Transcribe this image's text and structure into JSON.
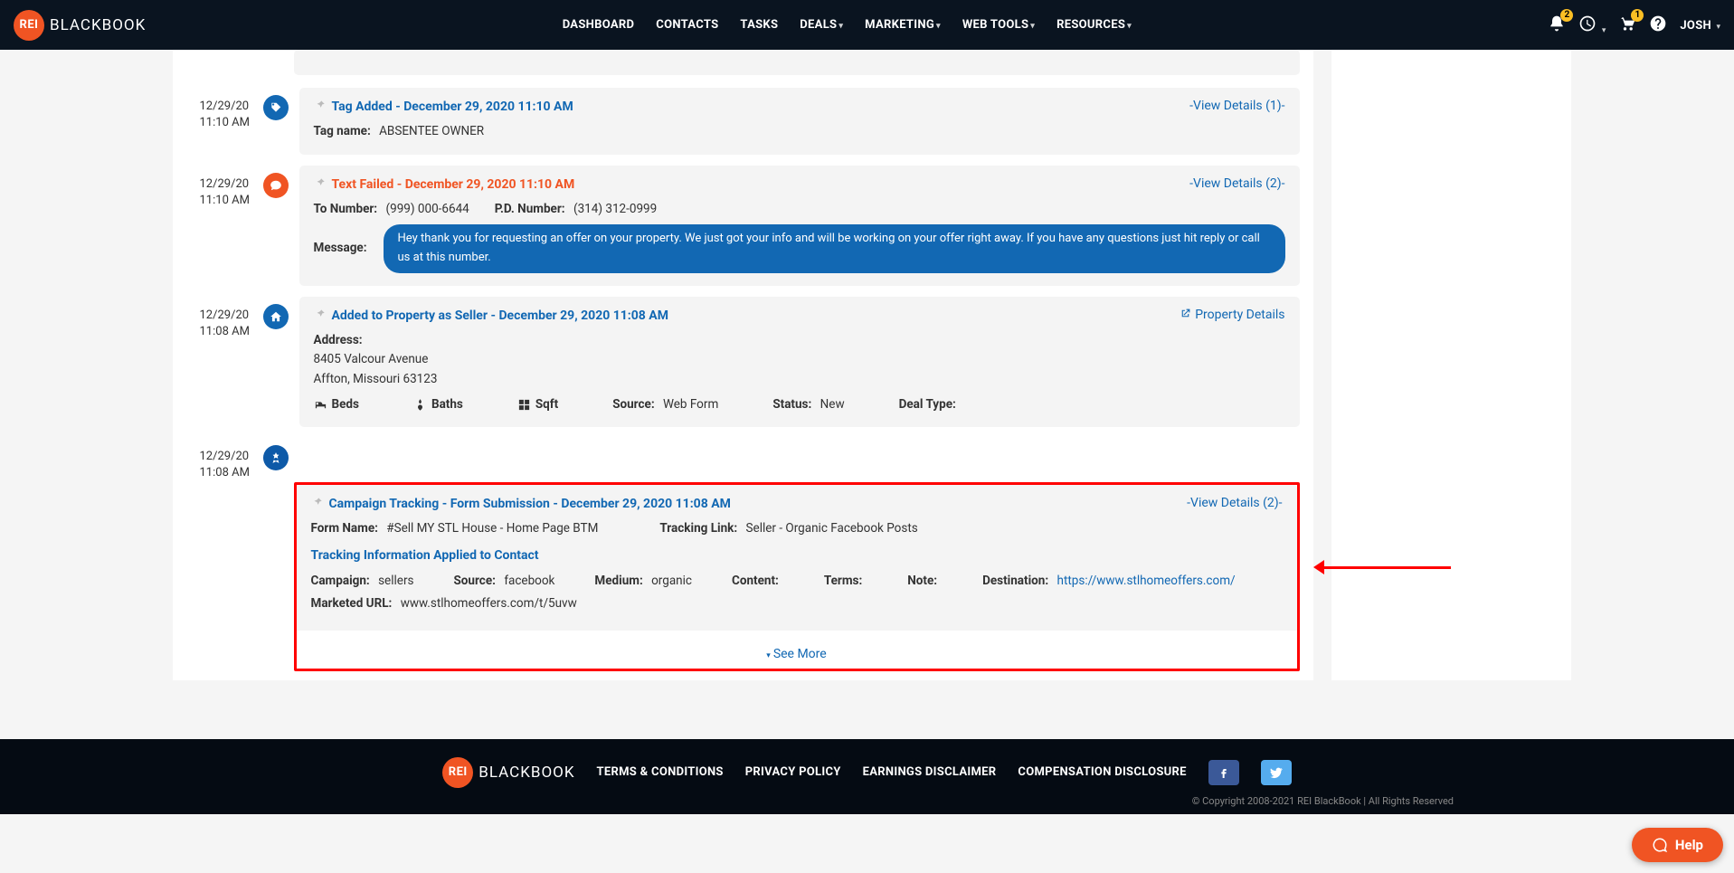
{
  "header": {
    "logo_badge": "REI",
    "logo_text": "BLACKBOOK",
    "nav": [
      "DASHBOARD",
      "CONTACTS",
      "TASKS",
      "DEALS",
      "MARKETING",
      "WEB TOOLS",
      "RESOURCES"
    ],
    "nav_carets": [
      false,
      false,
      false,
      true,
      true,
      true,
      true
    ],
    "bell_badge": "2",
    "cart_badge": "1",
    "user": "JOSH"
  },
  "items": [
    {
      "date": "12/29/20",
      "time": "11:10 AM",
      "icon": "tag",
      "icon_color": "blue",
      "title": "Tag Added - December 29, 2020 11:10 AM",
      "title_class": "blue",
      "action": "-View Details (1)-",
      "lines": [
        {
          "label": "Tag name:",
          "value": "ABSENTEE OWNER"
        }
      ]
    },
    {
      "date": "12/29/20",
      "time": "11:10 AM",
      "icon": "comment",
      "icon_color": "orange",
      "title": "Text Failed - December 29, 2020 11:10 AM",
      "title_class": "red",
      "action": "-View Details (2)-",
      "text_row": {
        "to_label": "To Number:",
        "to_val": "(999) 000-6644",
        "pd_label": "P.D. Number:",
        "pd_val": "(314) 312-0999"
      },
      "msg_label": "Message:",
      "msg": "Hey thank you for requesting an offer on your property. We just got your info and will be working on your offer right away. If you have any questions just hit reply or call us at this number."
    },
    {
      "date": "12/29/20",
      "time": "11:08 AM",
      "icon": "home",
      "icon_color": "blue",
      "title": "Added to Property as Seller - December 29, 2020 11:08 AM",
      "title_class": "blue",
      "action_label": "Property Details",
      "address_label": "Address:",
      "address1": "8405 Valcour Avenue",
      "address2": "Affton, Missouri 63123",
      "props": {
        "beds": "Beds",
        "baths": "Baths",
        "sqft": "Sqft",
        "source_lbl": "Source:",
        "source_val": "Web Form",
        "status_lbl": "Status:",
        "status_val": "New",
        "deal_lbl": "Deal Type:"
      }
    },
    {
      "date": "12/29/20",
      "time": "11:08 AM",
      "icon": "certificate",
      "icon_color": "dblue",
      "title": "Campaign Tracking - Form Submission - December 29, 2020 11:08 AM",
      "title_class": "blue",
      "action": "-View Details (2)-",
      "form_row": {
        "form_lbl": "Form Name:",
        "form_val": "#Sell MY STL House - Home Page BTM",
        "tl_lbl": "Tracking Link:",
        "tl_val": "Seller - Organic Facebook Posts"
      },
      "sub": "Tracking Information Applied to Contact",
      "track_row": {
        "camp_lbl": "Campaign:",
        "camp_val": "sellers",
        "src_lbl": "Source:",
        "src_val": "facebook",
        "med_lbl": "Medium:",
        "med_val": "organic",
        "cont_lbl": "Content:",
        "terms_lbl": "Terms:",
        "note_lbl": "Note:",
        "dest_lbl": "Destination:",
        "dest_val": "https://www.stlhomeoffers.com/"
      },
      "murl_lbl": "Marketed URL:",
      "murl_val": "www.stlhomeoffers.com/t/5uvw",
      "see_more": "See More"
    }
  ],
  "footer": {
    "logo_badge": "REI",
    "logo_text": "BLACKBOOK",
    "links": [
      "TERMS & CONDITIONS",
      "PRIVACY POLICY",
      "EARNINGS DISCLAIMER",
      "COMPENSATION DISCLOSURE"
    ],
    "copyright": "© Copyright 2008-2021 REI BlackBook | All Rights Reserved"
  },
  "help_label": "Help"
}
